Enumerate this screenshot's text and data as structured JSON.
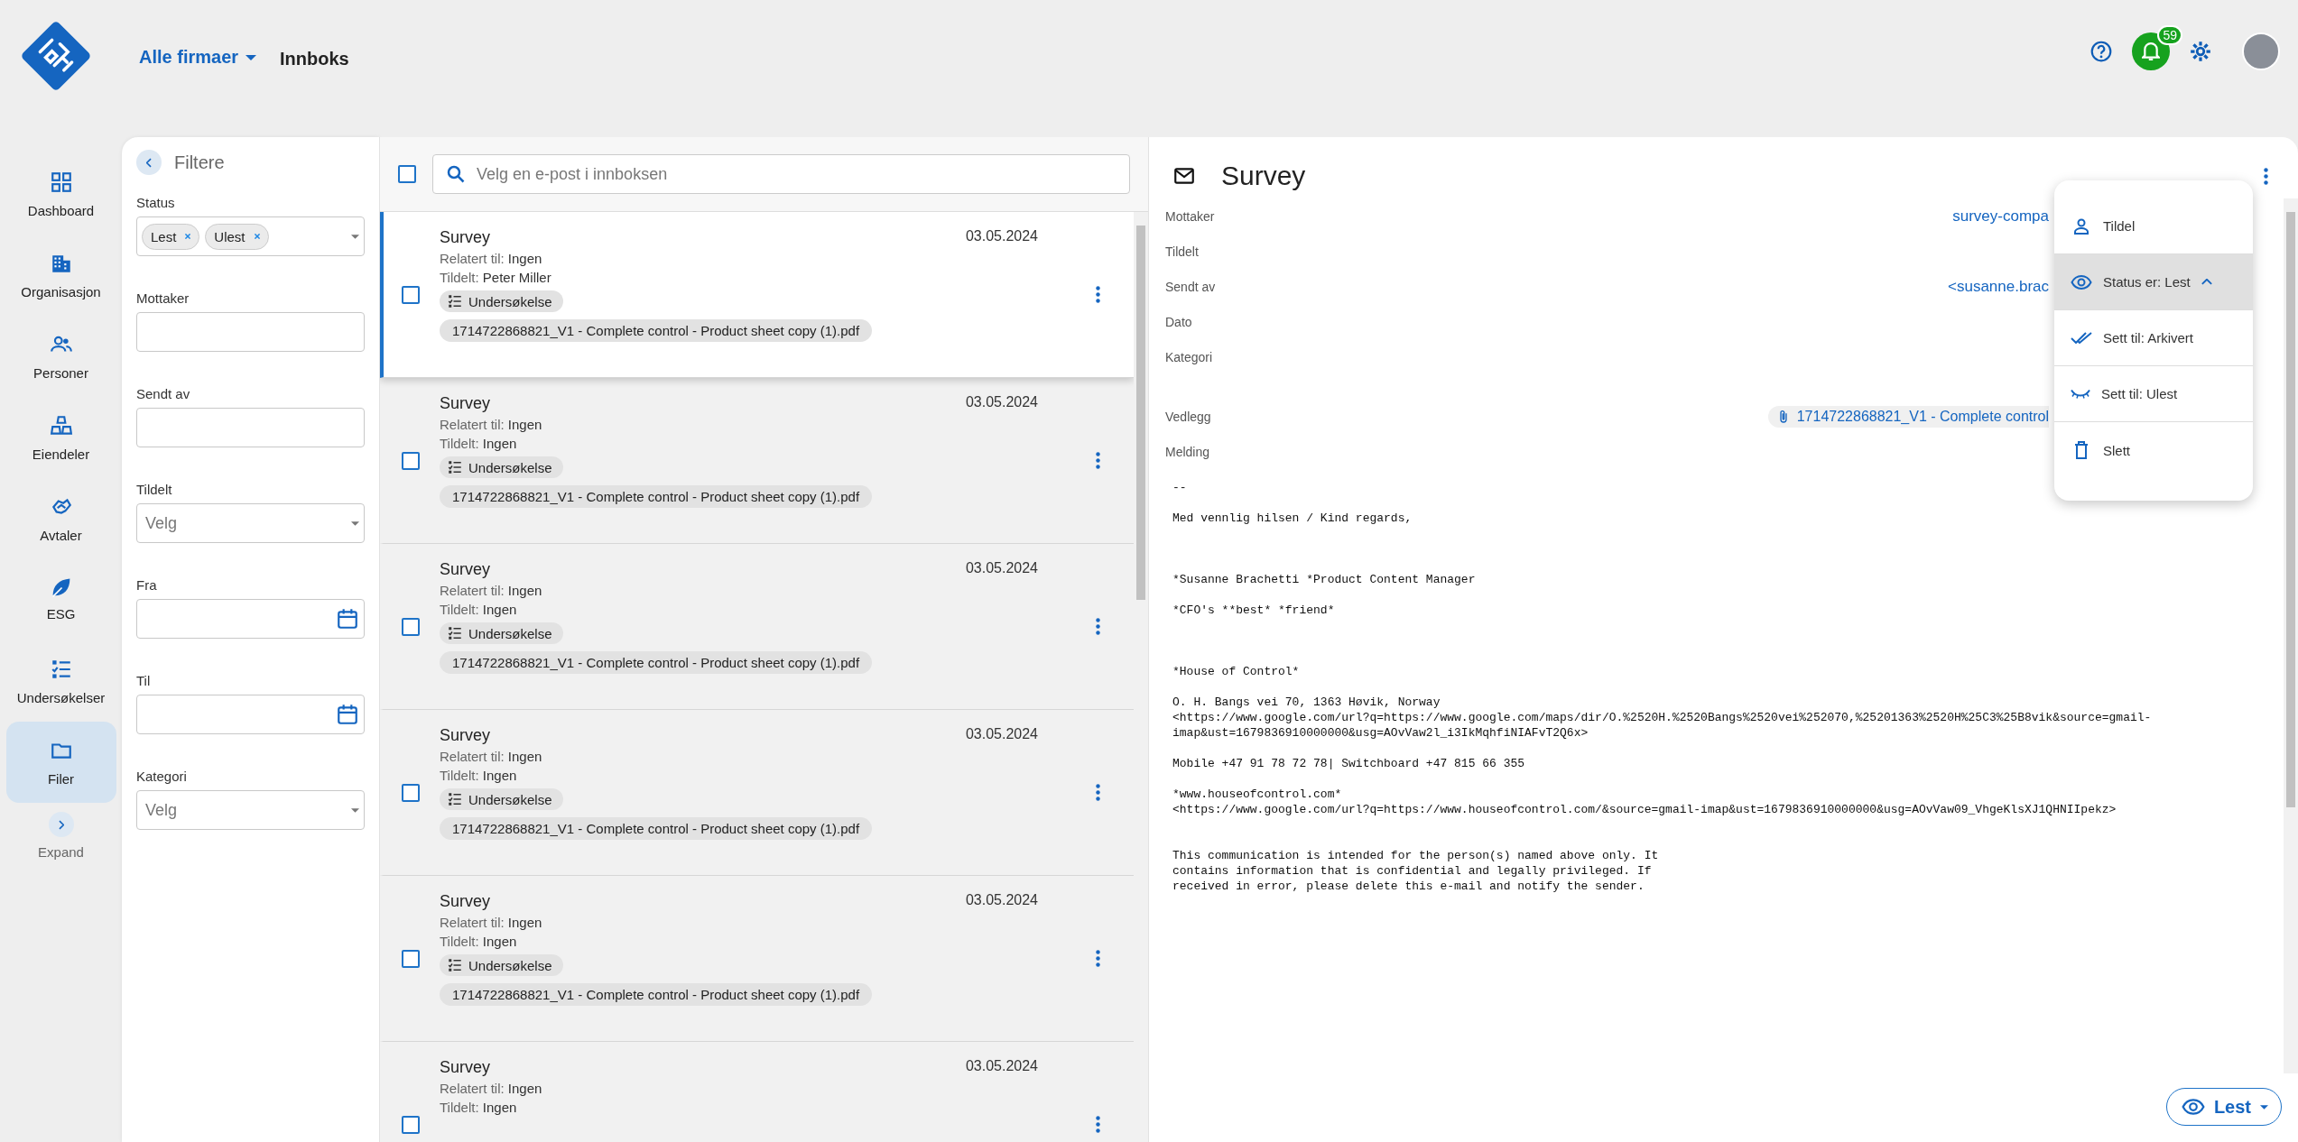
{
  "app": {
    "company_selector": "Alle firmaer",
    "page_title": "Innboks",
    "notifications_count": "59"
  },
  "nav": {
    "items": [
      {
        "label": "Dashboard",
        "selected": false
      },
      {
        "label": "Organisasjon",
        "selected": false
      },
      {
        "label": "Personer",
        "selected": false
      },
      {
        "label": "Eiendeler",
        "selected": false
      },
      {
        "label": "Avtaler",
        "selected": false
      },
      {
        "label": "ESG",
        "selected": false
      },
      {
        "label": "Undersøkelser",
        "selected": false
      },
      {
        "label": "Filer",
        "selected": true
      }
    ],
    "expand_label": "Expand"
  },
  "filters": {
    "title": "Filtere",
    "fields": [
      {
        "label": "Status",
        "kind": "chips",
        "chips": [
          "Lest",
          "Ulest"
        ]
      },
      {
        "label": "Mottaker",
        "kind": "text"
      },
      {
        "label": "Sendt av",
        "kind": "text"
      },
      {
        "label": "Tildelt",
        "kind": "select",
        "placeholder": "Velg"
      },
      {
        "label": "Fra",
        "kind": "date"
      },
      {
        "label": "Til",
        "kind": "date"
      },
      {
        "label": "Kategori",
        "kind": "select",
        "placeholder": "Velg"
      }
    ]
  },
  "inbox": {
    "search": {
      "placeholder": "Velg en e-post i innboksen"
    },
    "select_all_checked": false,
    "emails": [
      {
        "subject": "Survey",
        "date": "03.05.2024",
        "related_label": "Relatert til:",
        "related": "Ingen",
        "assigned_label": "Tildelt:",
        "assigned": "Peter Miller",
        "tag": "Undersøkelse",
        "attachment": "1714722868821_V1 - Complete control - Product sheet copy (1).pdf",
        "checked": false,
        "selected": true
      },
      {
        "subject": "Survey",
        "date": "03.05.2024",
        "related_label": "Relatert til:",
        "related": "Ingen",
        "assigned_label": "Tildelt:",
        "assigned": "Ingen",
        "tag": "Undersøkelse",
        "attachment": "1714722868821_V1 - Complete control - Product sheet copy (1).pdf",
        "checked": false,
        "selected": false
      },
      {
        "subject": "Survey",
        "date": "03.05.2024",
        "related_label": "Relatert til:",
        "related": "Ingen",
        "assigned_label": "Tildelt:",
        "assigned": "Ingen",
        "tag": "Undersøkelse",
        "attachment": "1714722868821_V1 - Complete control - Product sheet copy (1).pdf",
        "checked": false,
        "selected": false
      },
      {
        "subject": "Survey",
        "date": "03.05.2024",
        "related_label": "Relatert til:",
        "related": "Ingen",
        "assigned_label": "Tildelt:",
        "assigned": "Ingen",
        "tag": "Undersøkelse",
        "attachment": "1714722868821_V1 - Complete control - Product sheet copy (1).pdf",
        "checked": false,
        "selected": false
      },
      {
        "subject": "Survey",
        "date": "03.05.2024",
        "related_label": "Relatert til:",
        "related": "Ingen",
        "assigned_label": "Tildelt:",
        "assigned": "Ingen",
        "tag": "Undersøkelse",
        "attachment": "1714722868821_V1 - Complete control - Product sheet copy (1).pdf",
        "checked": false,
        "selected": false
      },
      {
        "subject": "Survey",
        "date": "03.05.2024",
        "related_label": "Relatert til:",
        "related": "Ingen",
        "assigned_label": "Tildelt:",
        "assigned": "Ingen",
        "checked": false,
        "selected": false
      }
    ]
  },
  "detail": {
    "subject": "Survey",
    "fields": [
      {
        "label": "Mottaker",
        "kind": "text",
        "value": "survey-compa"
      },
      {
        "label": "Tildelt",
        "kind": "text"
      },
      {
        "label": "Sendt av",
        "kind": "text",
        "value": "<susanne.brac"
      },
      {
        "label": "Dato",
        "kind": "text"
      },
      {
        "label": "Kategori",
        "kind": "text"
      },
      {
        "label": "Vedlegg",
        "kind": "attachment",
        "value": "1714722868821_V1 - Complete control"
      },
      {
        "label": "Melding",
        "kind": "text"
      }
    ],
    "message": "--\n\nMed vennlig hilsen / Kind regards,\n\n\n\n*Susanne Brachetti *Product Content Manager\n\n*CFO's **best* *friend*\n\n\n\n*House of Control*\n\nO. H. Bangs vei 70, 1363 Høvik, Norway\n<https://www.google.com/url?q=https://www.google.com/maps/dir/O.%2520H.%2520Bangs%2520vei%252070,%25201363%2520H%25C3%25B8vik&source=gmail-\nimap&ust=1679836910000000&usg=AOvVaw2l_i3IkMqhfiNIAFvT2Q6x>\n\nMobile +47 91 78 72 78| Switchboard +47 815 66 355\n\n*www.houseofcontrol.com*\n<https://www.google.com/url?q=https://www.houseofcontrol.com/&source=gmail-imap&ust=1679836910000000&usg=AOvVaw09_VhgeKlsXJ1QHNIIpekz>\n\n\nThis communication is intended for the person(s) named above only. It\ncontains information that is confidential and legally privileged. If\nreceived in error, please delete this e-mail and notify the sender.",
    "menu": {
      "items": [
        {
          "label": "Tildel",
          "selected": false
        },
        {
          "label": "Status er: Lest",
          "selected": true,
          "expanded": true
        },
        {
          "label": "Sett til: Arkivert",
          "selected": false
        },
        {
          "label": "Sett til: Ulest",
          "selected": false
        },
        {
          "label": "Slett",
          "selected": false
        }
      ]
    },
    "status_button": "Lest"
  }
}
